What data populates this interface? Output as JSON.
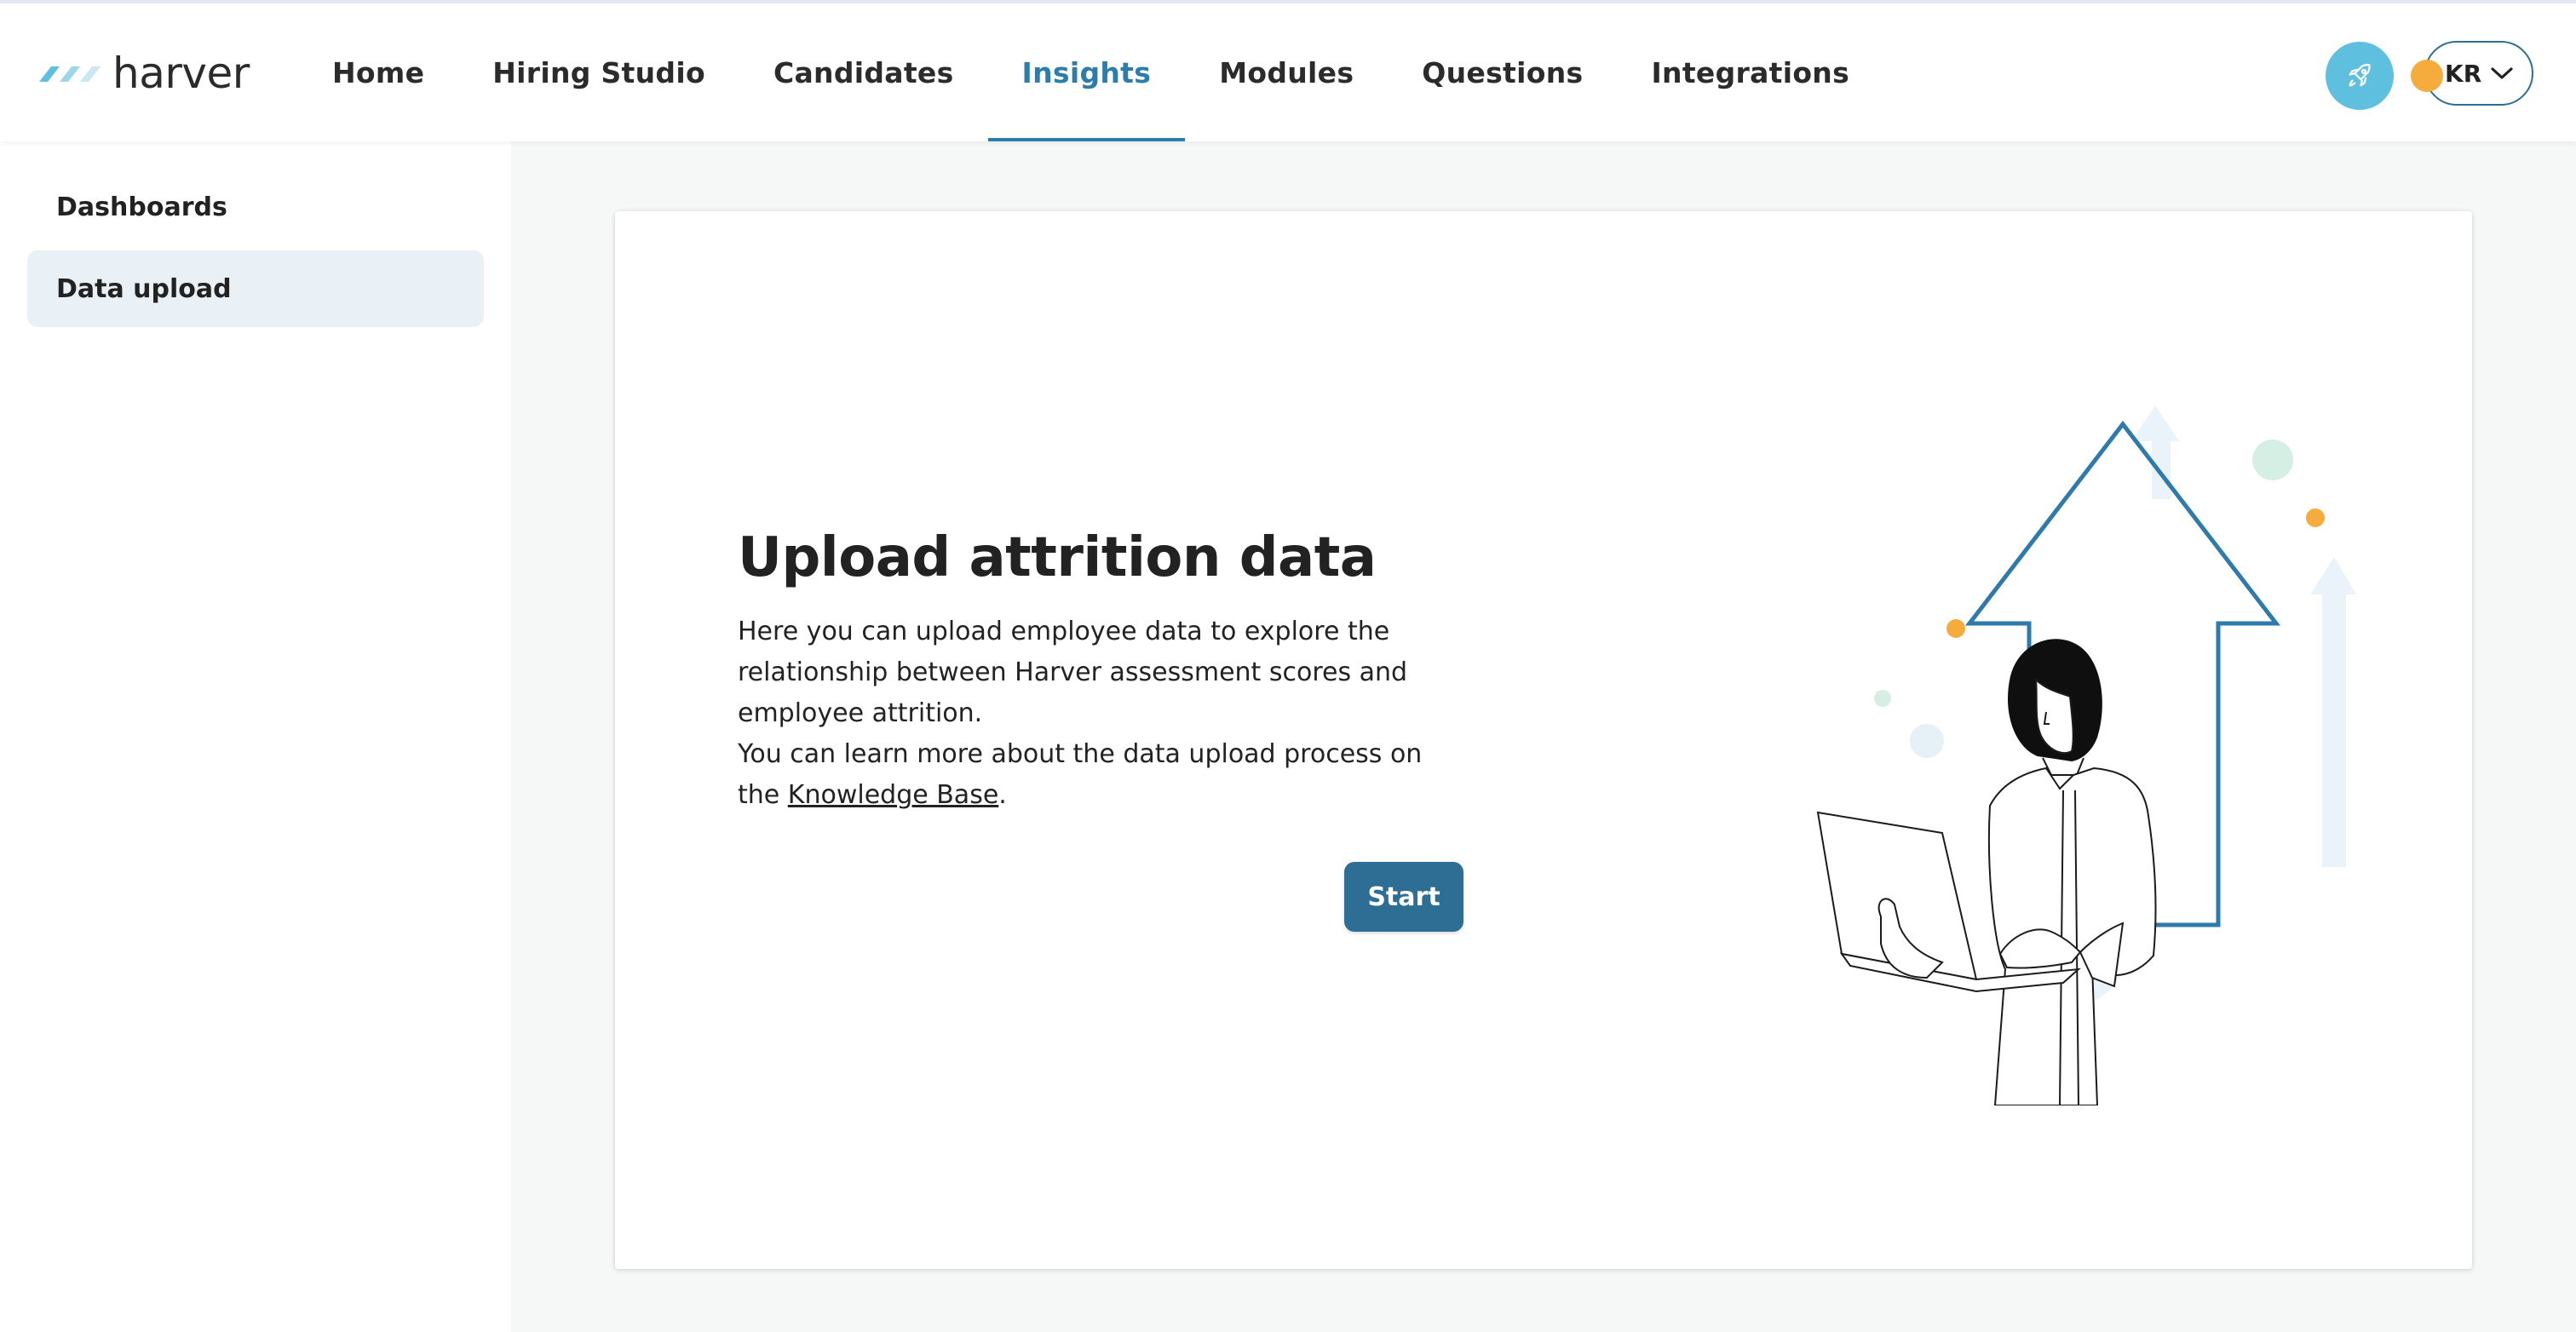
{
  "app": {
    "logo_text": "harver"
  },
  "nav": {
    "items": [
      {
        "label": "Home",
        "active": false
      },
      {
        "label": "Hiring Studio",
        "active": false
      },
      {
        "label": "Candidates",
        "active": false
      },
      {
        "label": "Insights",
        "active": true
      },
      {
        "label": "Modules",
        "active": false
      },
      {
        "label": "Questions",
        "active": false
      },
      {
        "label": "Integrations",
        "active": false
      }
    ]
  },
  "header_actions": {
    "rocket_icon": "rocket-icon",
    "user_initials": "KR",
    "status_color": "#f6ac3c"
  },
  "sidebar": {
    "items": [
      {
        "label": "Dashboards",
        "active": false
      },
      {
        "label": "Data upload",
        "active": true
      }
    ]
  },
  "main": {
    "title": "Upload attrition data",
    "paragraph1": "Here you can upload employee data to explore the relationship between Harver assessment scores and employee attrition.",
    "paragraph2_prefix": "You can learn more about the data upload process on the",
    "link_text": "Knowledge Base",
    "paragraph2_suffix": ".",
    "start_label": "Start"
  },
  "colors": {
    "accent": "#2b7eab",
    "primary_button": "#2e6d94",
    "rocket_bg": "#5ebfdf",
    "sidebar_active_bg": "#e9f1f6"
  }
}
